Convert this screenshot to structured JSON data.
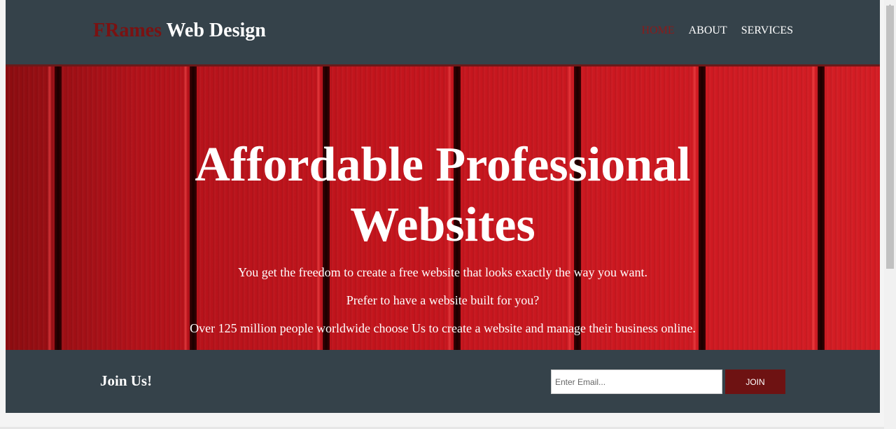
{
  "header": {
    "brand_accent": "FRames",
    "brand_rest": " Web Design",
    "nav": [
      {
        "label": "HOME",
        "active": true
      },
      {
        "label": "ABOUT",
        "active": false
      },
      {
        "label": "SERVICES",
        "active": false
      }
    ]
  },
  "hero": {
    "title_line1": "Affordable Professional",
    "title_line2": "Websites",
    "text1": "You get the freedom to create a free website that looks exactly the way you want.",
    "text2": "Prefer to have a website built for you?",
    "text3": "Over 125 million people worldwide choose Us to create a website and manage their business online."
  },
  "newsletter": {
    "title": "Join Us!",
    "email_placeholder": "Enter Email...",
    "email_value": "",
    "button_label": "JOIN"
  },
  "colors": {
    "header_bg": "#35424a",
    "accent": "#7a1212",
    "hero_red": "#c2141c",
    "button_bg": "#6e1212"
  }
}
